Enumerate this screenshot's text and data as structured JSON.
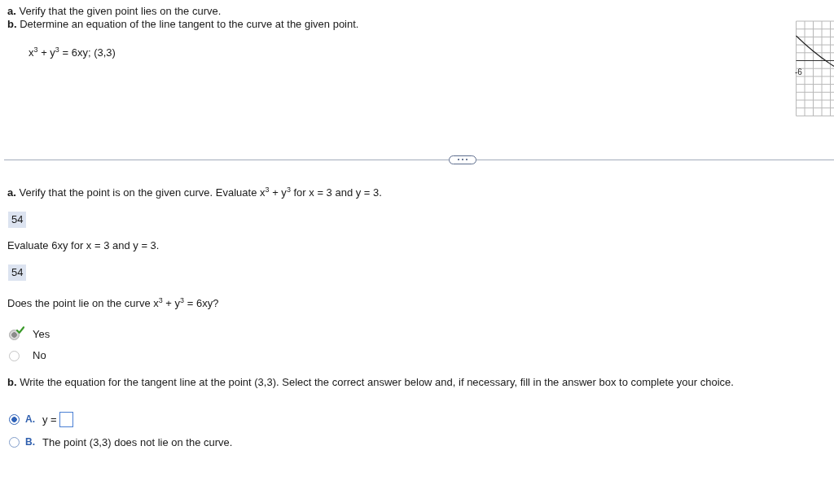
{
  "problem": {
    "lines": [
      "**a.** Verify that the given point lies on the curve.",
      "**b.** Determine an equation of the line tangent to the curve at the given point."
    ],
    "equation": "x$^{3}$ + y$^{3}$ = 6xy; (3,3)"
  },
  "graph_thumbnail": {
    "axis_label": "-6"
  },
  "part_a": {
    "steps": [
      {
        "prompt": "**a.** Verify that the point is on the given curve. Evaluate x$^{3}$ + y$^{3}$ for x = 3 and y = 3.",
        "answer": "54"
      },
      {
        "prompt": "Evaluate 6xy for x = 3 and y = 3.",
        "answer": "54"
      }
    ],
    "question": "Does the point lie on the curve x$^{3}$ + y$^{3}$ = 6xy?",
    "options": [
      {
        "label": "Yes",
        "selected": true,
        "correct": true
      },
      {
        "label": "No",
        "selected": false,
        "correct": false
      }
    ]
  },
  "part_b": {
    "prompt": "**b.** Write the equation for the tangent line at the point (3,3). Select the correct answer below and, if necessary, fill in the answer box to complete your choice.",
    "choices": [
      {
        "letter": "A.",
        "text": "y =",
        "kind": "answer_box",
        "selected": true
      },
      {
        "letter": "B.",
        "text": "The point (3,3) does not lie on the curve.",
        "kind": "text",
        "selected": false
      }
    ]
  }
}
